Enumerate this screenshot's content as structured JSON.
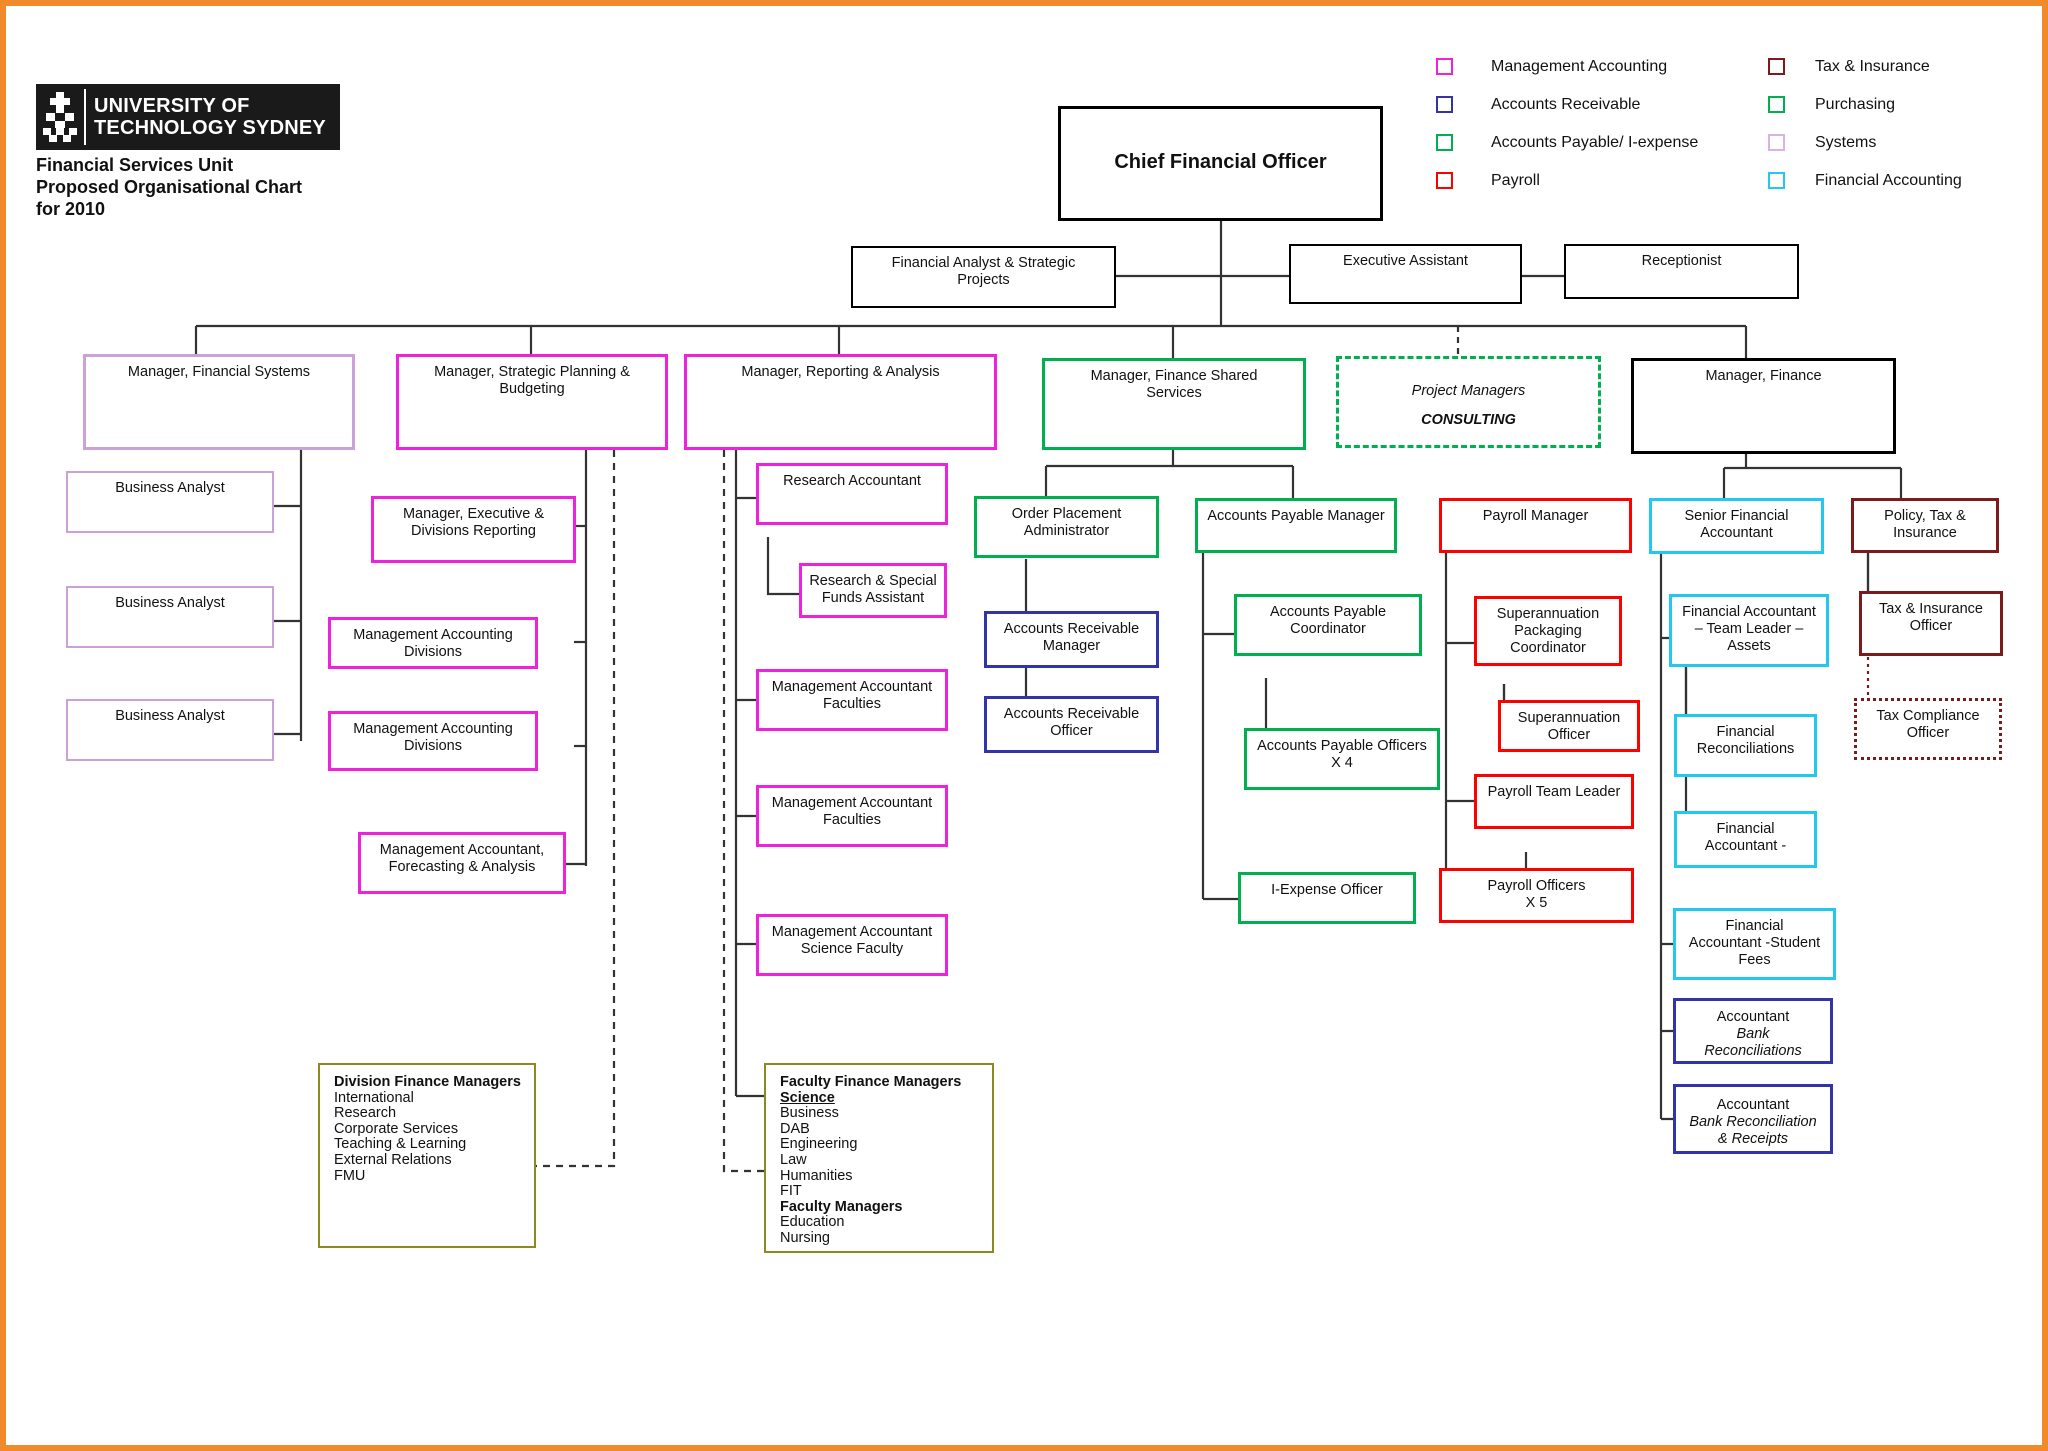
{
  "brand": {
    "logo_line1": "UNIVERSITY OF",
    "logo_line2": "TECHNOLOGY SYDNEY",
    "logo_mark_icon": "uts-knot-logo-icon",
    "title_line1": "Financial Services Unit",
    "title_line2": "Proposed Organisational Chart",
    "title_line3": "for 2010"
  },
  "legend": {
    "column1": [
      {
        "label": "Management Accounting",
        "color": "#ee22dd"
      },
      {
        "label": "Accounts Receivable",
        "color": "#3333aa"
      },
      {
        "label": "Accounts Payable/ I-expense",
        "color": "#00b050"
      },
      {
        "label": "Payroll",
        "color": "#ff0000"
      }
    ],
    "column2": [
      {
        "label": "Tax & Insurance",
        "color": "#7b1b1b"
      },
      {
        "label": "Purchasing",
        "color": "#00b050"
      },
      {
        "label": "Systems",
        "color": "#d9b3e6"
      },
      {
        "label": "Financial Accounting",
        "color": "#22c8f0"
      }
    ]
  },
  "nodes": {
    "cfo": "Chief Financial Officer",
    "financial_analyst": "Financial Analyst & Strategic\nProjects",
    "executive_assistant": "Executive Assistant",
    "receptionist": "Receptionist",
    "mgr_financial_systems": "Manager, Financial Systems",
    "mgr_strategic_planning": "Manager, Strategic Planning &\nBudgeting",
    "mgr_reporting_analysis": "Manager, Reporting & Analysis",
    "mgr_finance_shared_services": "Manager, Finance Shared\nServices",
    "project_managers": "Project Managers",
    "project_managers_sub": "CONSULTING",
    "mgr_finance": "Manager, Finance",
    "business_analyst_1": "Business Analyst",
    "business_analyst_2": "Business Analyst",
    "business_analyst_3": "Business Analyst",
    "mgr_exec_divisions_reporting": "Manager, Executive &\nDivisions Reporting",
    "mgmt_accounting_divisions_1": "Management Accounting\nDivisions",
    "mgmt_accounting_divisions_2": "Management Accounting\nDivisions",
    "mgmt_accountant_forecasting": "Management Accountant,\nForecasting & Analysis",
    "research_accountant": "Research Accountant",
    "research_special_funds": "Research & Special\nFunds Assistant",
    "mgmt_accountant_faculties_1": "Management Accountant\nFaculties",
    "mgmt_accountant_faculties_2": "Management Accountant\nFaculties",
    "mgmt_accountant_science": "Management Accountant\nScience Faculty",
    "order_placement_admin": "Order Placement\nAdministrator",
    "accounts_receivable_manager": "Accounts Receivable\nManager",
    "accounts_receivable_officer": "Accounts Receivable\nOfficer",
    "accounts_payable_manager": "Accounts Payable Manager",
    "accounts_payable_coordinator": "Accounts Payable\nCoordinator",
    "accounts_payable_officers": "Accounts Payable Officers\nX 4",
    "i_expense_officer": "I-Expense Officer",
    "payroll_manager": "Payroll Manager",
    "superannuation_packaging": "Superannuation\nPackaging\nCoordinator",
    "superannuation_officer": "Superannuation\nOfficer",
    "payroll_team_leader": "Payroll Team Leader",
    "payroll_officers": "Payroll Officers\nX 5",
    "senior_financial_accountant": "Senior Financial\nAccountant",
    "fa_team_leader_assets": "Financial Accountant\n– Team Leader –\nAssets",
    "financial_reconciliations": "Financial\nReconciliations",
    "financial_accountant_dash": "Financial\nAccountant -",
    "fa_student_fees": "Financial\nAccountant -Student\nFees",
    "accountant_bank_recon_l1": "Accountant",
    "accountant_bank_recon_l2": "Bank\nReconciliations",
    "accountant_bank_recon_receipts_l1": "Accountant",
    "accountant_bank_recon_receipts_l2": "Bank Reconciliation\n& Receipts",
    "policy_tax_insurance": "Policy, Tax &\nInsurance",
    "tax_insurance_officer": "Tax & Insurance\nOfficer",
    "tax_compliance_officer": "Tax Compliance\nOfficer"
  },
  "division_finance_managers": {
    "heading": "Division Finance Managers",
    "items": [
      "International",
      "Research",
      "Corporate Services",
      "Teaching & Learning",
      "External Relations",
      "FMU"
    ]
  },
  "faculty_finance_managers": {
    "heading": "Faculty Finance Managers",
    "underlined": "Science",
    "items": [
      "Business",
      "DAB",
      "Engineering",
      "Law",
      "Humanities",
      "FIT"
    ],
    "subheading": "Faculty Managers",
    "subitems": [
      "Education",
      "Nursing"
    ]
  },
  "colors": {
    "management_accounting": "#ee22dd",
    "accounts_receivable": "#3333aa",
    "accounts_payable": "#00b050",
    "payroll": "#ff0000",
    "tax_insurance": "#7b1b1b",
    "purchasing": "#00b050",
    "systems": "#cba2d8",
    "financial_accounting": "#22c8f0",
    "default": "#000000",
    "list_border": "#8a8a20",
    "page_border": "#f08a2a"
  }
}
